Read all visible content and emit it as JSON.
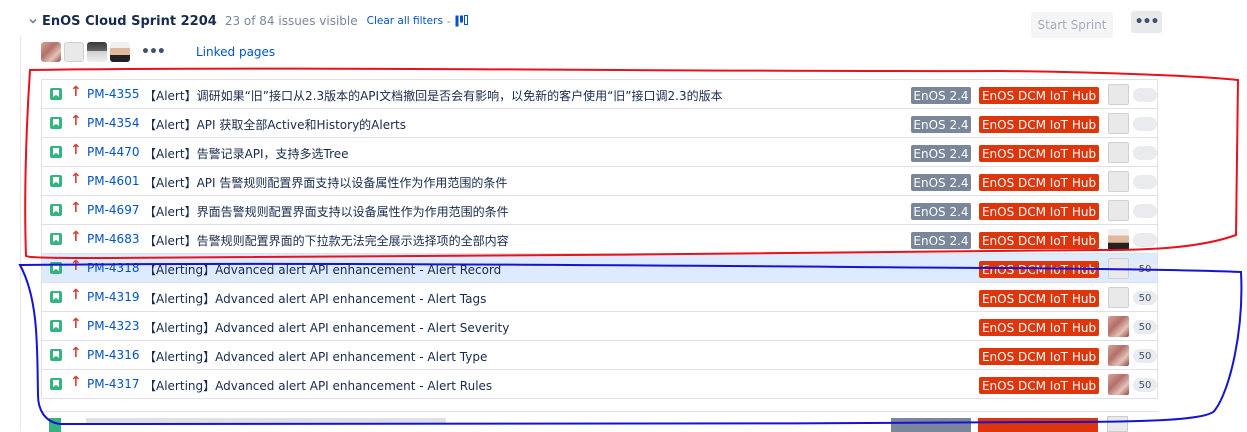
{
  "sprint": {
    "name": "EnOS Cloud Sprint 2204",
    "visible_count": "23 of 84 issues visible",
    "clear_filters": "Clear all filters",
    "separator": "-",
    "start_sprint": "Start Sprint",
    "more": "•••",
    "avatars_more": "•••",
    "linked_pages": "Linked pages"
  },
  "issues": [
    {
      "key": "PM-4355",
      "summary": "【Alert】调研如果“旧”接口从2.3版本的API文档撤回是否会有影响，以免新的客户使用“旧”接口调2.3的版本",
      "version": "EnOS 2.4",
      "epic": "EnOS DCM IoT Hub",
      "assignee": "grey",
      "estimate": ""
    },
    {
      "key": "PM-4354",
      "summary": "【Alert】API 获取全部Active和History的Alerts",
      "version": "EnOS 2.4",
      "epic": "EnOS DCM IoT Hub",
      "assignee": "grey",
      "estimate": ""
    },
    {
      "key": "PM-4470",
      "summary": "【Alert】告警记录API，支持多选Tree",
      "version": "EnOS 2.4",
      "epic": "EnOS DCM IoT Hub",
      "assignee": "grey",
      "estimate": ""
    },
    {
      "key": "PM-4601",
      "summary": "【Alert】API 告警规则配置界面支持以设备属性作为作用范围的条件",
      "version": "EnOS 2.4",
      "epic": "EnOS DCM IoT Hub",
      "assignee": "grey",
      "estimate": ""
    },
    {
      "key": "PM-4697",
      "summary": "【Alert】界面告警规则配置界面支持以设备属性作为作用范围的条件",
      "version": "EnOS 2.4",
      "epic": "EnOS DCM IoT Hub",
      "assignee": "grey",
      "estimate": ""
    },
    {
      "key": "PM-4683",
      "summary": "【Alert】告警规则配置界面的下拉款无法完全展示选择项的全部内容",
      "version": "EnOS 2.4",
      "epic": "EnOS DCM IoT Hub",
      "assignee": "man",
      "estimate": ""
    },
    {
      "key": "PM-4318",
      "summary": "【Alerting】Advanced alert API enhancement - Alert Record",
      "version": "",
      "epic": "EnOS DCM IoT Hub",
      "assignee": "grey",
      "estimate": "50"
    },
    {
      "key": "PM-4319",
      "summary": "【Alerting】Advanced alert API enhancement - Alert Tags",
      "version": "",
      "epic": "EnOS DCM IoT Hub",
      "assignee": "grey",
      "estimate": "50"
    },
    {
      "key": "PM-4323",
      "summary": "【Alerting】Advanced alert API enhancement - Alert Severity",
      "version": "",
      "epic": "EnOS DCM IoT Hub",
      "assignee": "photo",
      "estimate": "50"
    },
    {
      "key": "PM-4316",
      "summary": "【Alerting】Advanced alert API enhancement - Alert Type",
      "version": "",
      "epic": "EnOS DCM IoT Hub",
      "assignee": "photo",
      "estimate": "50"
    },
    {
      "key": "PM-4317",
      "summary": "【Alerting】Advanced alert API enhancement - Alert Rules",
      "version": "",
      "epic": "EnOS DCM IoT Hub",
      "assignee": "photo",
      "estimate": "50"
    }
  ],
  "colors": {
    "link": "#0052cc",
    "story": "#36b37e",
    "priority_high": "#d04437",
    "version_badge": "#7a869a",
    "epic_badge": "#de350b",
    "selected_row": "#deebff",
    "annotation_red": "#e8121c",
    "annotation_blue": "#1414d2"
  },
  "icons": {
    "collapse": "chevron-down-icon",
    "board": "board-view-icon",
    "issue_type": "story-icon",
    "priority": "priority-high-arrow-icon"
  }
}
